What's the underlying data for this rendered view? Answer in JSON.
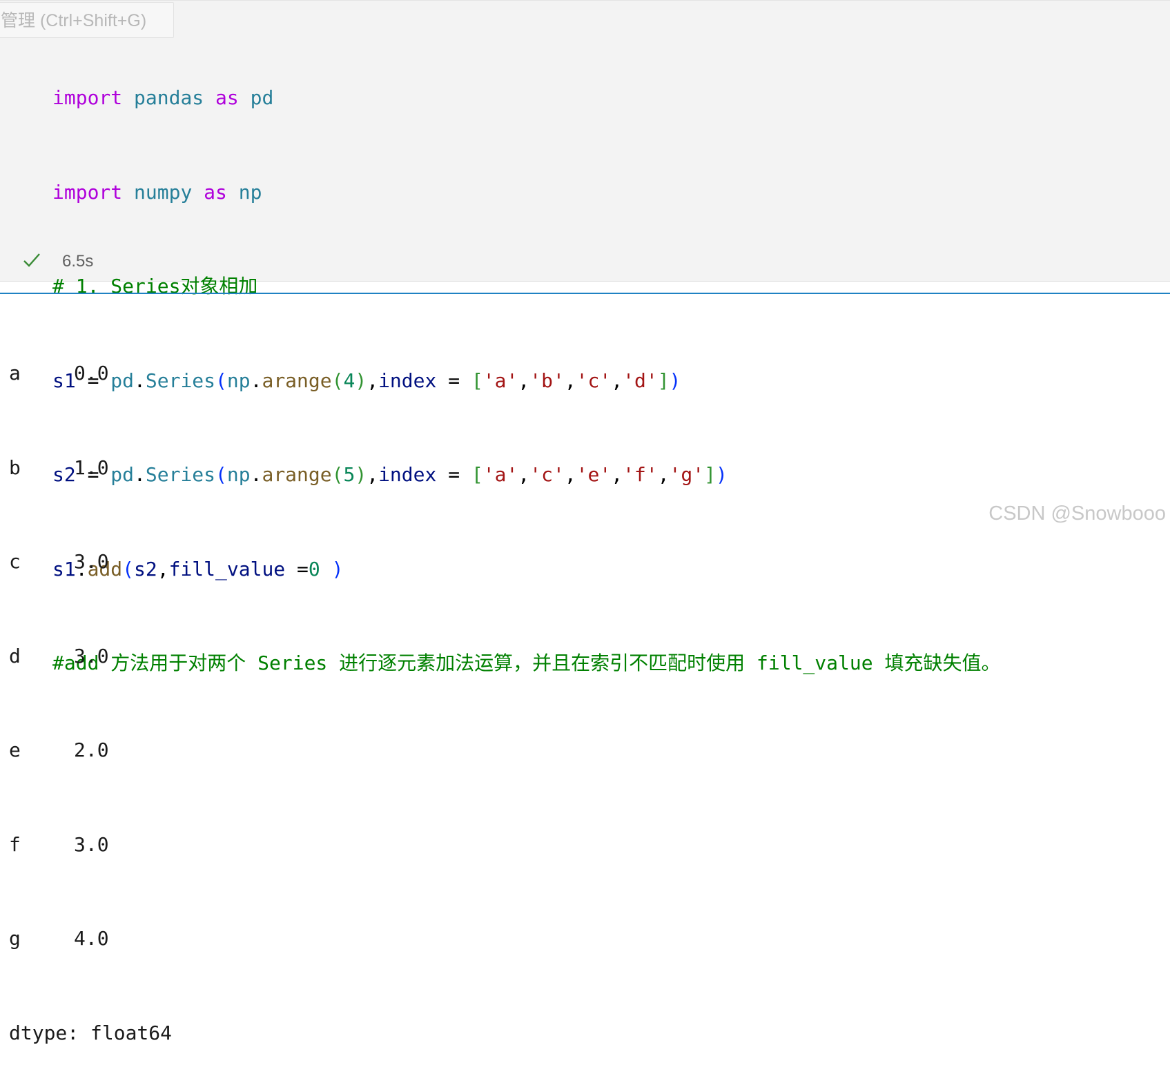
{
  "tooltip": {
    "text": "管理 (Ctrl+Shift+G)"
  },
  "code": {
    "l1": {
      "a": "import",
      "b": " ",
      "c": "pandas",
      "d": " ",
      "e": "as",
      "f": " ",
      "g": "pd"
    },
    "l2": {
      "a": "import",
      "b": " ",
      "c": "numpy",
      "d": " ",
      "e": "as",
      "f": " ",
      "g": "np"
    },
    "l3": {
      "a": "# 1. Series对象相加"
    },
    "l4": {
      "a": "s1",
      "b": " = ",
      "c": "pd",
      "d": ".",
      "e": "Series",
      "f": "(",
      "g": "np",
      "h": ".",
      "i": "arange",
      "j": "(",
      "k": "4",
      "l": ")",
      "m": ",",
      "n": "index",
      "o": " = ",
      "p": "[",
      "q": "'a'",
      "r": ",",
      "s": "'b'",
      "t": ",",
      "u": "'c'",
      "v": ",",
      "w": "'d'",
      "x": "]",
      "y": ")"
    },
    "l5": {
      "a": "s2",
      "b": " = ",
      "c": "pd",
      "d": ".",
      "e": "Series",
      "f": "(",
      "g": "np",
      "h": ".",
      "i": "arange",
      "j": "(",
      "k": "5",
      "l": ")",
      "m": ",",
      "n": "index",
      "o": " = ",
      "p": "[",
      "q": "'a'",
      "r": ",",
      "s": "'c'",
      "t": ",",
      "u": "'e'",
      "v": ",",
      "w": "'f'",
      "x": ",",
      "y": "'g'",
      "z": "]",
      "aa": ")"
    },
    "l6": {
      "a": "s1",
      "b": ".",
      "c": "add",
      "d": "(",
      "e": "s2",
      "f": ",",
      "g": "fill_value",
      "h": " =",
      "i": "0",
      "j": " ",
      "k": ")"
    },
    "l7": {
      "a": "#add 方法用于对两个 Series 进行逐元素加法运算，并且在索引不匹配时使用 fill_value 填充缺失值。"
    }
  },
  "status": {
    "check_icon": "check-icon",
    "time": "6.5s",
    "check_color": "#388a34"
  },
  "output": {
    "rows": [
      {
        "index": "a",
        "value": "0.0"
      },
      {
        "index": "b",
        "value": "1.0"
      },
      {
        "index": "c",
        "value": "3.0"
      },
      {
        "index": "d",
        "value": "3.0"
      },
      {
        "index": "e",
        "value": "2.0"
      },
      {
        "index": "f",
        "value": "3.0"
      },
      {
        "index": "g",
        "value": "4.0"
      }
    ],
    "dtype": "dtype: float64"
  },
  "watermark": {
    "text": "CSDN @Snowbooo"
  },
  "colors": {
    "divider": "#1f82c3",
    "cell_bg": "#f3f3f3"
  }
}
